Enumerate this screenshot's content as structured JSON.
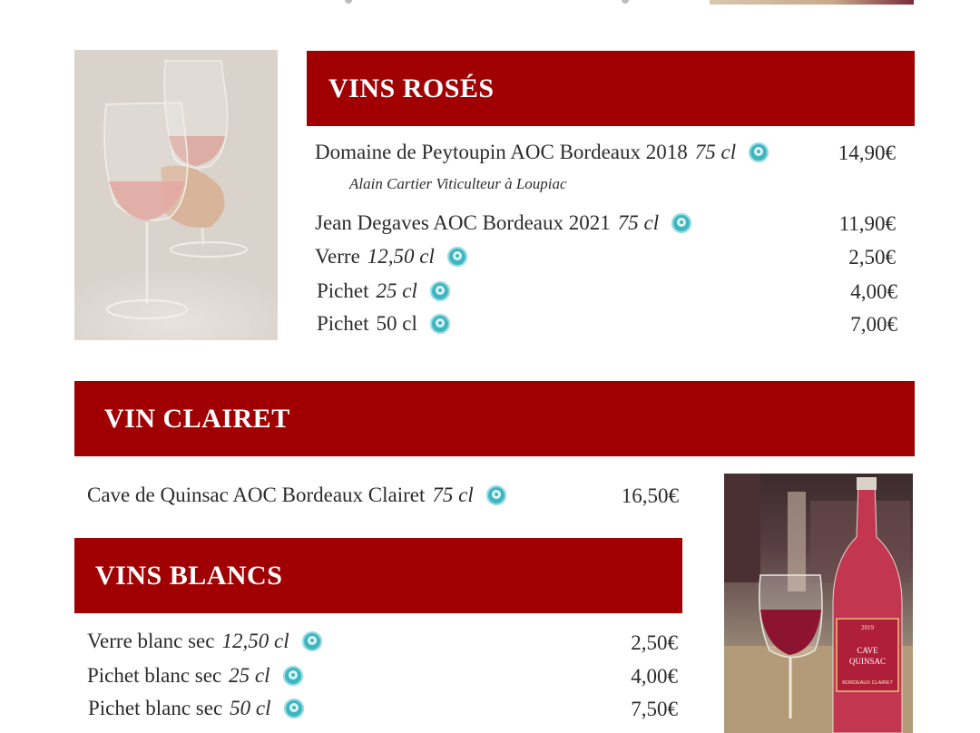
{
  "sections": {
    "roses": {
      "title": "VINS ROSÉS",
      "items": [
        {
          "name": "Domaine de Peytoupin AOC Bordeaux 2018",
          "volume": "75 cl",
          "price": "14,90€",
          "producer": "Alain Cartier Viticulteur à Loupiac"
        },
        {
          "name": "Jean Degaves AOC Bordeaux 2021",
          "volume": "75 cl",
          "price": "11,90€"
        },
        {
          "name": "Verre",
          "volume": "12,50 cl",
          "price": "2,50€"
        },
        {
          "name": "Pichet",
          "volume": "25 cl",
          "price": "4,00€"
        },
        {
          "name": "Pichet",
          "volume": "50 cl",
          "price": "7,00€"
        }
      ]
    },
    "clairet": {
      "title": "VIN CLAIRET",
      "items": [
        {
          "name": "Cave de Quinsac AOC Bordeaux Clairet",
          "volume": "75 cl",
          "price": "16,50€"
        }
      ]
    },
    "blancs": {
      "title": "VINS BLANCS",
      "items": [
        {
          "name": "Verre blanc sec",
          "volume": "12,50 cl",
          "price": "2,50€"
        },
        {
          "name": "Pichet blanc sec",
          "volume": "25 cl",
          "price": "4,00€"
        },
        {
          "name": "Pichet blanc sec",
          "volume": "50 cl",
          "price": "7,50€"
        }
      ]
    }
  },
  "bottle_label": {
    "year": "2019",
    "brand_line1": "CAVE",
    "brand_line2": "QUINSAC",
    "appellation": "BORDEAUX CLAIRET"
  },
  "colors": {
    "header_red": "#a10003",
    "badge_teal": "#3eb6c1"
  },
  "icons": {
    "eco_badge": "eco-label-badge-icon"
  }
}
